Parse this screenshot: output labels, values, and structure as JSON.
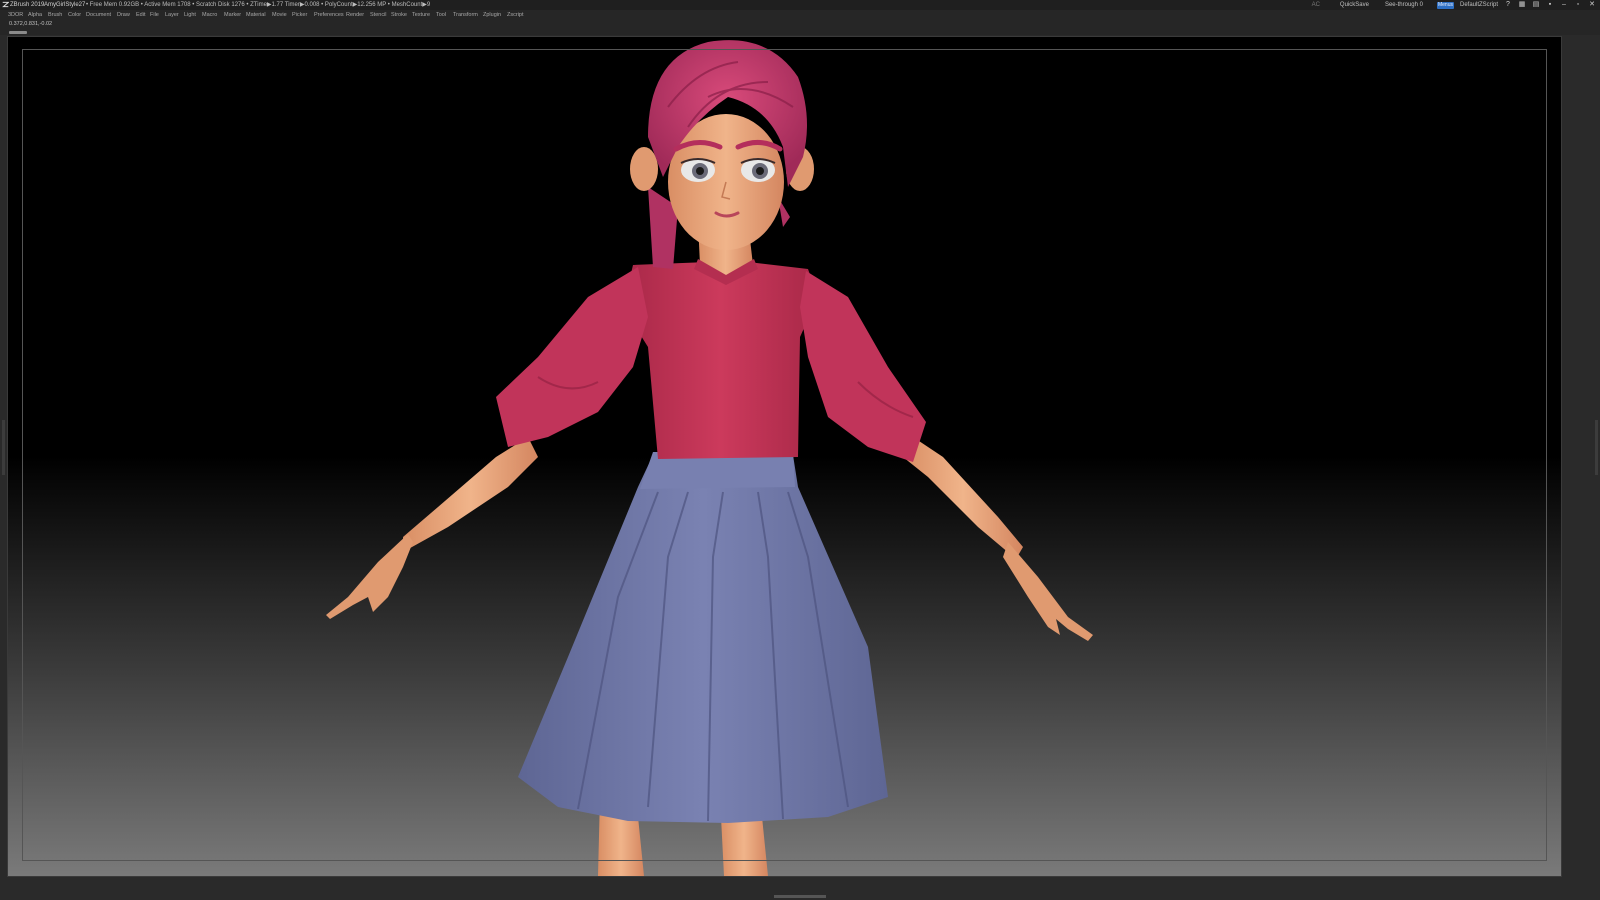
{
  "titlebar": {
    "app_title": "ZBrush 2019",
    "document_name": "AmyGirlStyle27",
    "stats": "• Free Mem 0.92GB • Active Mem 1708 • Scratch Disk 1276 • ZTime▶1.77 Timer▶0.008 • PolyCount▶12.256 MP • MeshCount▶9",
    "ac": "AC",
    "quicksave": "QuickSave",
    "see_through_label": "See-through",
    "see_through_value": "0",
    "see_through_level": 0,
    "menus": "Menus",
    "script": "DefaultZScript"
  },
  "menubar": {
    "items": [
      "3DOR",
      "Alpha",
      "Brush",
      "Color",
      "Document",
      "Draw",
      "Edit",
      "File",
      "Layer",
      "Light",
      "Macro",
      "Marker",
      "Material",
      "Movie",
      "Picker",
      "Preferences",
      "Render",
      "Stencil",
      "Stroke",
      "Texture",
      "Tool",
      "Transform",
      "Zplugin",
      "Zscript"
    ]
  },
  "status": {
    "coordinates": "0.372,0.831,-0.02"
  },
  "icons": {
    "app_logo": "zbrush-logo-icon",
    "help": "help-icon",
    "layout": "layout-icon",
    "lock": "lock-icon",
    "minimize": "minimize-icon",
    "restore": "restore-icon",
    "close": "close-icon"
  },
  "colors": {
    "hair": "#c8386a",
    "shirt": "#c43455",
    "skirt": "#7078a8",
    "skin": "#e8a87c",
    "menus_toggle": "#2d6fc4",
    "slider_accent": "#e0a22a"
  }
}
